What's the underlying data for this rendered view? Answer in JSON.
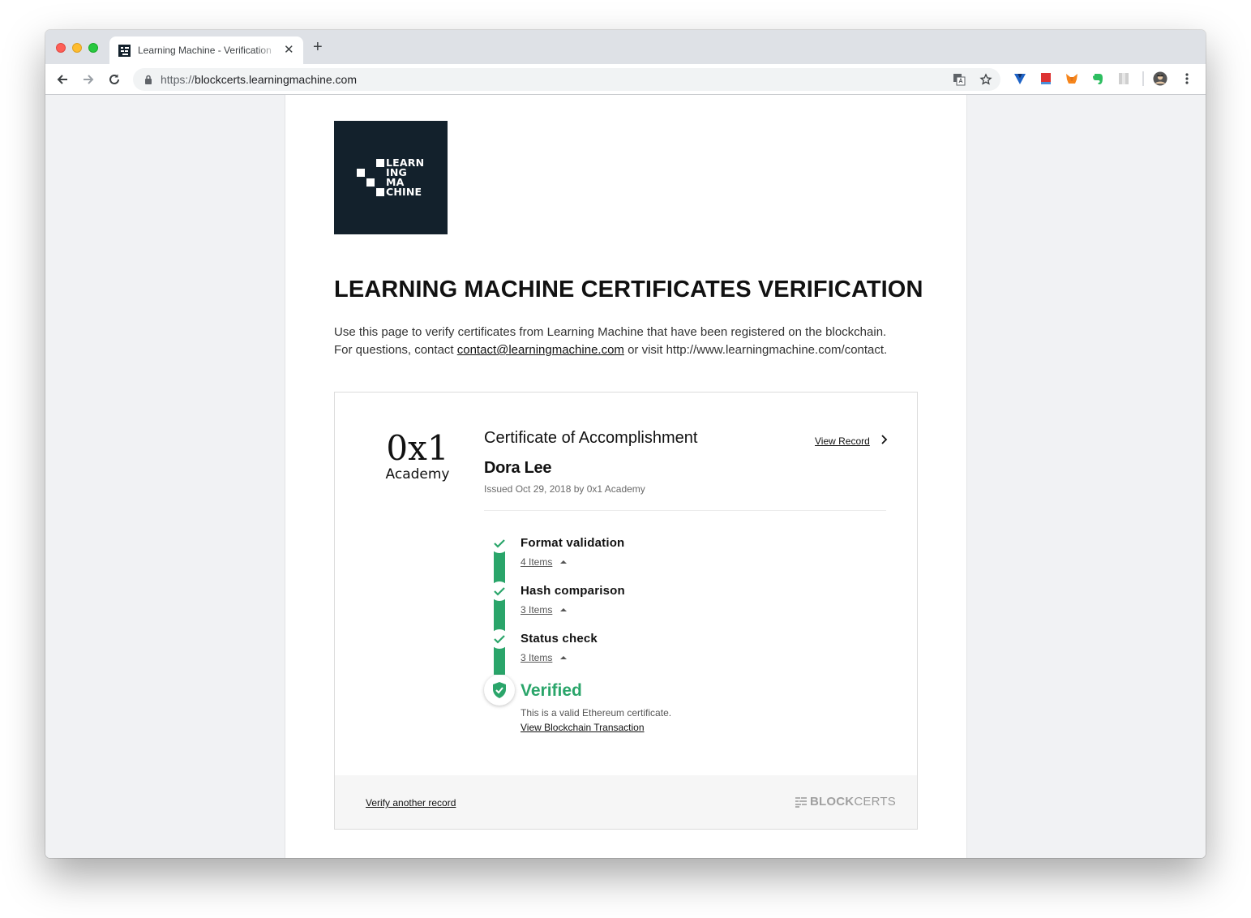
{
  "browser": {
    "tab_title": "Learning Machine - Verification",
    "tab_close": "✕",
    "new_tab": "+",
    "url_scheme": "https://",
    "url_host": "blockcerts.learningmachine.com"
  },
  "brand": {
    "logo_lines": [
      "LEARN",
      "ING",
      "MA",
      "CHINE"
    ],
    "logo_bg": "#13212c"
  },
  "page": {
    "title": "LEARNING MACHINE CERTIFICATES VERIFICATION",
    "intro_line1": "Use this page to verify certificates from Learning Machine that have been registered on the blockchain.",
    "intro_prefix": "For questions, contact ",
    "contact_email": "contact@learningmachine.com",
    "intro_suffix": " or visit http://www.learningmachine.com/contact."
  },
  "certificate": {
    "issuer_logo_top": "0x1",
    "issuer_logo_bottom": "Academy",
    "title": "Certificate of Accomplishment",
    "recipient": "Dora Lee",
    "issued": "Issued Oct 29, 2018 by 0x1 Academy",
    "view_record": "View Record"
  },
  "steps": [
    {
      "title": "Format validation",
      "items": "4 Items"
    },
    {
      "title": "Hash comparison",
      "items": "3 Items"
    },
    {
      "title": "Status check",
      "items": "3 Items"
    }
  ],
  "result": {
    "status": "Verified",
    "message": "This is a valid Ethereum certificate.",
    "tx_link": "View Blockchain Transaction",
    "color": "#2aa56a"
  },
  "footer": {
    "verify_another": "Verify another record",
    "brand_bold": "BLOCK",
    "brand_light": "CERTS"
  }
}
